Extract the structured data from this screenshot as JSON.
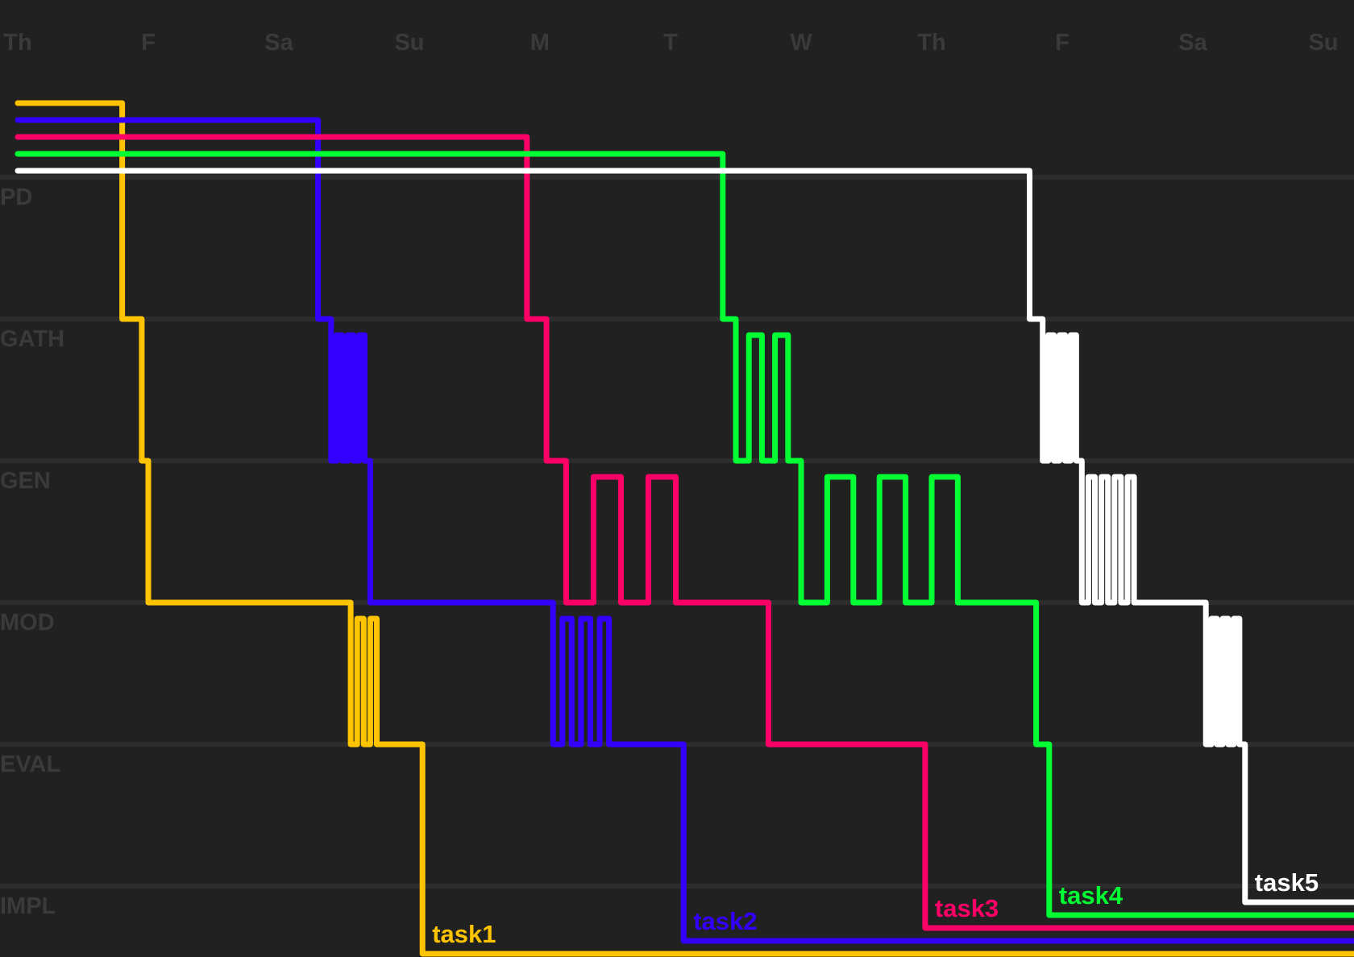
{
  "colors": {
    "background": "#212121",
    "grid": "#2d2d2d",
    "axis_text": "#3a3a3a"
  },
  "chart_data": {
    "type": "line",
    "x_axis": {
      "position": "top",
      "tick_labels": [
        "Th",
        "F",
        "Sa",
        "Su",
        "M",
        "T",
        "W",
        "Th",
        "F",
        "Sa",
        "Su"
      ],
      "range_days": [
        0,
        10
      ]
    },
    "y_axis": {
      "categories": [
        "PD",
        "GATH",
        "GEN",
        "MOD",
        "EVAL",
        "IMPL"
      ]
    },
    "grid": true,
    "legend": "inline labels at line ends",
    "series": [
      {
        "name": "task1",
        "color": "#ffc400",
        "key_points": [
          [
            0,
            0
          ],
          [
            0.8,
            0
          ],
          [
            0.95,
            1
          ],
          [
            1.0,
            2
          ],
          [
            1.15,
            3
          ],
          [
            2.55,
            3
          ],
          [
            2.8,
            4
          ],
          [
            3.1,
            4
          ],
          [
            3.1,
            5
          ],
          [
            11,
            5
          ]
        ]
      },
      {
        "name": "task2",
        "color": "#3300ff",
        "key_points": [
          [
            0,
            0
          ],
          [
            2.3,
            0
          ],
          [
            2.4,
            1
          ],
          [
            2.7,
            2
          ],
          [
            2.85,
            3
          ],
          [
            4.1,
            3
          ],
          [
            4.6,
            4
          ],
          [
            5.1,
            4
          ],
          [
            5.1,
            5
          ],
          [
            11,
            5
          ]
        ]
      },
      {
        "name": "task3",
        "color": "#ff0066",
        "key_points": [
          [
            0,
            0
          ],
          [
            3.9,
            0
          ],
          [
            4.05,
            1
          ],
          [
            4.2,
            2
          ],
          [
            5.25,
            3
          ],
          [
            5.75,
            3
          ],
          [
            5.9,
            4
          ],
          [
            6.95,
            4
          ],
          [
            6.95,
            5
          ],
          [
            11,
            5
          ]
        ]
      },
      {
        "name": "task4",
        "color": "#00ff33",
        "key_points": [
          [
            0,
            0
          ],
          [
            5.4,
            0
          ],
          [
            5.5,
            1
          ],
          [
            6.0,
            2
          ],
          [
            7.4,
            3
          ],
          [
            7.8,
            3
          ],
          [
            7.9,
            4
          ],
          [
            7.9,
            5
          ],
          [
            11,
            5
          ]
        ]
      },
      {
        "name": "task5",
        "color": "#ffffff",
        "key_points": [
          [
            0,
            0
          ],
          [
            7.75,
            0
          ],
          [
            7.85,
            1
          ],
          [
            8.15,
            2
          ],
          [
            8.6,
            3
          ],
          [
            9.1,
            3
          ],
          [
            9.4,
            4
          ],
          [
            9.4,
            5
          ],
          [
            11,
            5
          ]
        ]
      }
    ]
  }
}
